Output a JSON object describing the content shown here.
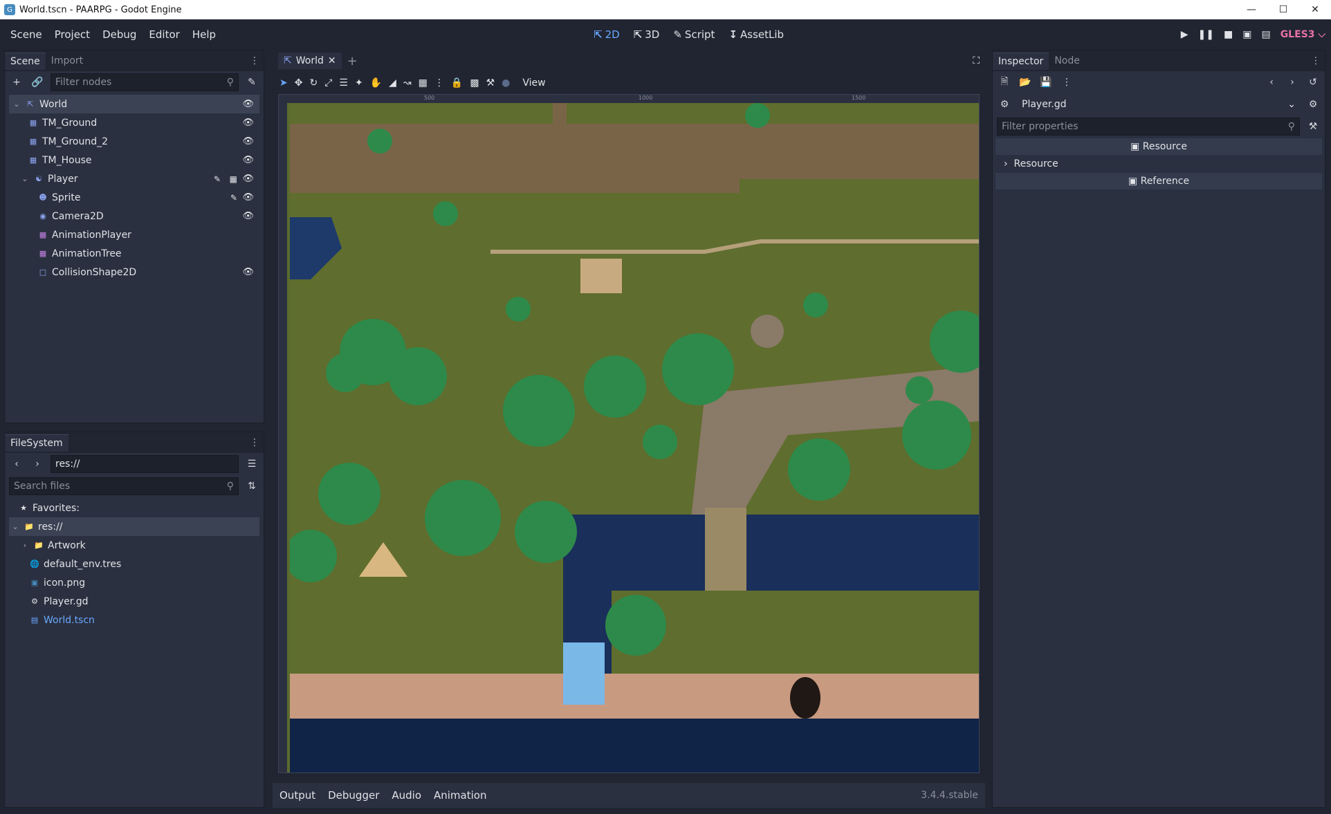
{
  "window": {
    "title": "World.tscn - PAARPG - Godot Engine"
  },
  "menu": {
    "items": [
      "Scene",
      "Project",
      "Debug",
      "Editor",
      "Help"
    ]
  },
  "workspaces": {
    "items": [
      "2D",
      "3D",
      "Script",
      "AssetLib"
    ],
    "active": "2D"
  },
  "renderer": "GLES3",
  "scene_panel": {
    "tabs": [
      "Scene",
      "Import"
    ],
    "filter_placeholder": "Filter nodes",
    "nodes": [
      {
        "label": "World",
        "depth": 0
      },
      {
        "label": "TM_Ground",
        "depth": 1
      },
      {
        "label": "TM_Ground_2",
        "depth": 1
      },
      {
        "label": "TM_House",
        "depth": 1
      },
      {
        "label": "Player",
        "depth": 1
      },
      {
        "label": "Sprite",
        "depth": 2
      },
      {
        "label": "Camera2D",
        "depth": 2
      },
      {
        "label": "AnimationPlayer",
        "depth": 2
      },
      {
        "label": "AnimationTree",
        "depth": 2
      },
      {
        "label": "CollisionShape2D",
        "depth": 2
      }
    ]
  },
  "filesystem": {
    "tab": "FileSystem",
    "path": "res://",
    "search_placeholder": "Search files",
    "items": [
      "Favorites:",
      "res://",
      "Artwork",
      "default_env.tres",
      "icon.png",
      "Player.gd",
      "World.tscn"
    ]
  },
  "editor": {
    "scene_tab": "World",
    "view_label": "View",
    "ruler_labels": [
      "500",
      "1000",
      "1500"
    ]
  },
  "bottom": {
    "tabs": [
      "Output",
      "Debugger",
      "Audio",
      "Animation"
    ],
    "version": "3.4.4.stable"
  },
  "inspector": {
    "tabs": [
      "Inspector",
      "Node"
    ],
    "resource": "Player.gd",
    "filter_placeholder": "Filter properties",
    "rows": [
      "Resource",
      "Resource",
      "Reference"
    ]
  },
  "colors": {
    "accent": "#6aa7ff",
    "gles": "#e872a8",
    "panel": "#2a3040",
    "bg": "#202531"
  }
}
